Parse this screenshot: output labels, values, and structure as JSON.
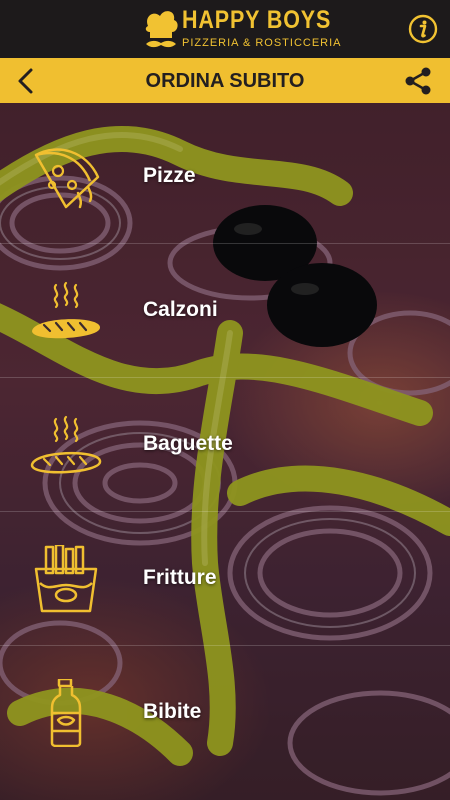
{
  "brand": {
    "title": "HAPPY BOYS",
    "subtitle": "PIZZERIA & ROSTICCERIA",
    "hat_icon": "chef-hat-mustache-icon",
    "accent": "#f0bf30",
    "dark": "#1d1a1b"
  },
  "topbar": {
    "info_icon": "info-icon"
  },
  "header": {
    "title": "ORDINA SUBITO",
    "back_icon": "chevron-left-icon",
    "share_icon": "share-icon"
  },
  "menu": [
    {
      "label": "Pizze",
      "icon": "pizza-slice-icon"
    },
    {
      "label": "Calzoni",
      "icon": "bread-steam-icon"
    },
    {
      "label": "Baguette",
      "icon": "bread-steam-icon"
    },
    {
      "label": "Fritture",
      "icon": "fries-icon"
    },
    {
      "label": "Bibite",
      "icon": "bottle-icon"
    }
  ]
}
